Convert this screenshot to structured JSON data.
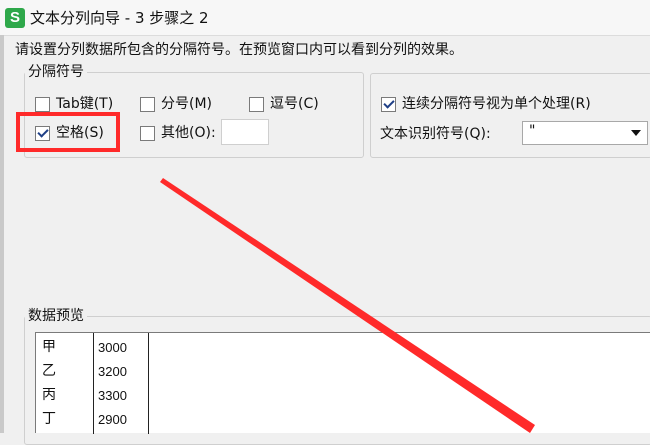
{
  "window": {
    "icon_letter": "S",
    "title": "文本分列向导 - 3 步骤之 2"
  },
  "instruction": "请设置分列数据所包含的分隔符号。在预览窗口内可以看到分列的效果。",
  "separators": {
    "legend": "分隔符号",
    "options": [
      {
        "label": "Tab键(T)",
        "checked": false
      },
      {
        "label": "分号(M)",
        "checked": false
      },
      {
        "label": "逗号(C)",
        "checked": false
      },
      {
        "label": "空格(S)",
        "checked": true
      },
      {
        "label": "其他(O):",
        "checked": false
      }
    ],
    "other_value": ""
  },
  "consecutive": {
    "label": "连续分隔符号视为单个处理(R)",
    "checked": true
  },
  "qualifier": {
    "label": "文本识别符号(Q):",
    "value": "\""
  },
  "preview": {
    "legend": "数据预览",
    "rows": [
      [
        "甲",
        "3000"
      ],
      [
        "乙",
        "3200"
      ],
      [
        "丙",
        "3300"
      ],
      [
        "丁",
        "2900"
      ]
    ]
  },
  "annotation_color": "#ff2a2a",
  "icons": [
    "app-icon",
    "checkbox",
    "dropdown-arrow-icon"
  ]
}
